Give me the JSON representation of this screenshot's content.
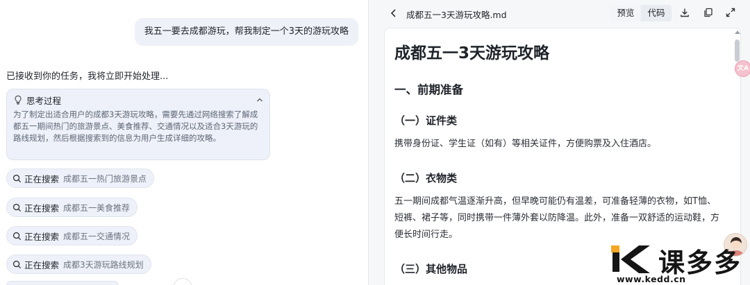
{
  "chat": {
    "user_message": "我五一要去成都游玩，帮我制定一个3天的游玩攻略",
    "ack_message": "已接收到你的任务，我将立即开始处理...",
    "thinking": {
      "title": "思考过程",
      "body": "为了制定出适合用户的成都3天游玩攻略，需要先通过网络搜索了解成都五一期间热门的旅游景点、美食推荐、交通情况以及适合3天游玩的路线规划，然后根据搜索到的信息为用户生成详细的攻略。",
      "icon": "lightbulb-icon",
      "collapse_icon": "chevron-up-icon"
    },
    "searches": [
      {
        "label": "正在搜索",
        "query": "成都五一热门旅游景点"
      },
      {
        "label": "正在搜索",
        "query": "成都五一美食推荐"
      },
      {
        "label": "正在搜索",
        "query": "成都五一交通情况"
      },
      {
        "label": "正在搜索",
        "query": "成都3天游玩路线规划"
      }
    ]
  },
  "preview": {
    "filename": "成都五一3天游玩攻略.md",
    "tabs": {
      "preview": "预览",
      "code": "代码"
    },
    "active_tab": "preview",
    "toolbar_icons": [
      "download-icon",
      "copy-icon",
      "expand-icon"
    ],
    "doc": {
      "h1": "成都五一3天游玩攻略",
      "h2": "一、前期准备",
      "sections": [
        {
          "heading": "（一）证件类",
          "text": "携带身份证、学生证（如有）等相关证件，方便购票及入住酒店。"
        },
        {
          "heading": "（二）衣物类",
          "text": "五一期间成都气温逐渐升高，但早晚可能仍有温差，可准备轻薄的衣物，如T恤、短裤、裙子等，同时携带一件薄外套以防降温。此外，准备一双舒适的运动鞋，方便长时间行走。"
        },
        {
          "heading": "（三）其他物品",
          "text": ""
        }
      ]
    }
  },
  "floating_badge": "文A",
  "watermark": {
    "brand": "课多多",
    "url": "www.kedd.cn"
  },
  "colors": {
    "accent_orange": "#f5a623",
    "bubble_bg": "#eef1f8",
    "doc_bg": "#ffffff"
  }
}
